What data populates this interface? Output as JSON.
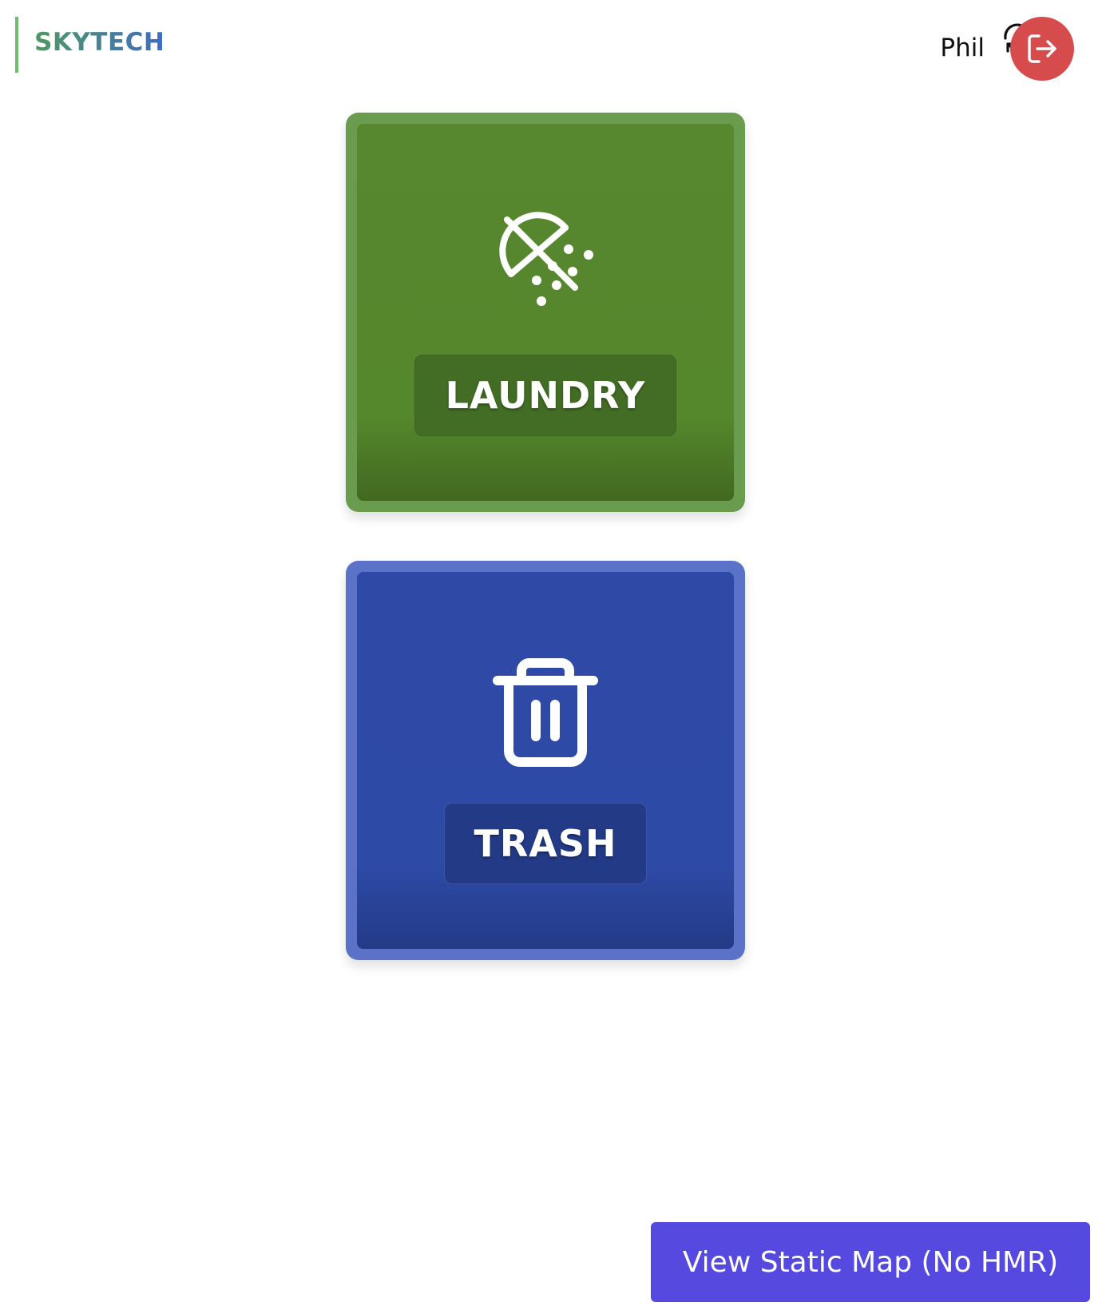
{
  "header": {
    "brand": "SKYTECH",
    "user_name": "Phil",
    "icons": {
      "refresh": "refresh-icon",
      "logout": "logout-icon"
    },
    "colors": {
      "brand_bar": "#6fbf6a",
      "logout_bg": "#d64b4b"
    }
  },
  "tiles": [
    {
      "label": "LAUNDRY",
      "icon": "shower-off-icon",
      "color": "#57872e"
    },
    {
      "label": "TRASH",
      "icon": "trash-icon",
      "color": "#2e4aa6"
    }
  ],
  "footer": {
    "map_button_label": "View Static Map (No HMR)",
    "map_button_color": "#5549e0"
  }
}
